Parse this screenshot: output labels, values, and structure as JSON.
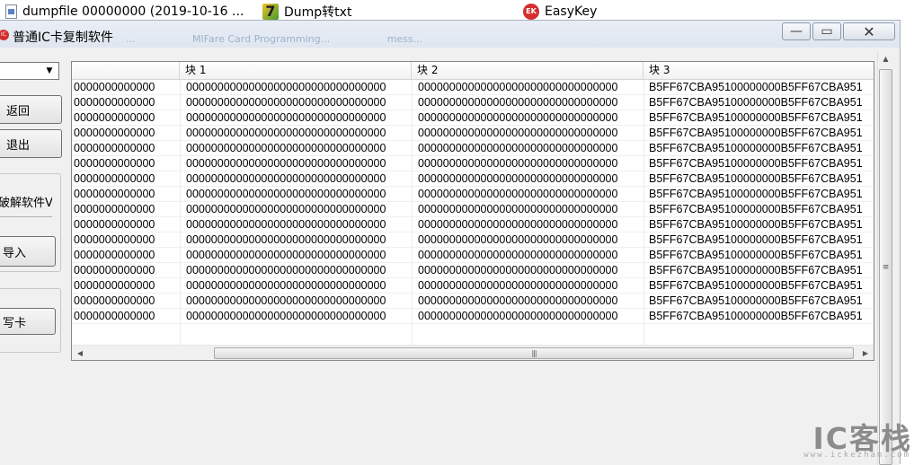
{
  "taskbar": {
    "items": [
      {
        "label": "dumpfile 00000000 (2019-10-16 ...",
        "icon": "file-icon"
      },
      {
        "label": "Dump转txt",
        "icon": "7zip-icon"
      },
      {
        "label": "EasyKey",
        "icon": "easykey-icon"
      }
    ]
  },
  "window": {
    "title": "普通IC卡复制软件",
    "background_tabs": [
      "...",
      "MIFare Card Programming...",
      "mess..."
    ],
    "caption": {
      "minimize": "—",
      "maximize": "▭",
      "close": "✕"
    }
  },
  "left_panel": {
    "combo_value": "",
    "back_label": "返回",
    "exit_label": "退出",
    "crack_label": "破解软件V",
    "import_label": "导入",
    "write_label": "写卡"
  },
  "grid": {
    "columns": [
      "",
      "块 1",
      "块 2",
      "块 3"
    ],
    "rows": [
      [
        "0000000000000",
        "00000000000000000000000000000000",
        "00000000000000000000000000000000",
        "B5FF67CBA95100000000B5FF67CBA951"
      ],
      [
        "0000000000000",
        "00000000000000000000000000000000",
        "00000000000000000000000000000000",
        "B5FF67CBA95100000000B5FF67CBA951"
      ],
      [
        "0000000000000",
        "00000000000000000000000000000000",
        "00000000000000000000000000000000",
        "B5FF67CBA95100000000B5FF67CBA951"
      ],
      [
        "0000000000000",
        "00000000000000000000000000000000",
        "00000000000000000000000000000000",
        "B5FF67CBA95100000000B5FF67CBA951"
      ],
      [
        "0000000000000",
        "00000000000000000000000000000000",
        "00000000000000000000000000000000",
        "B5FF67CBA95100000000B5FF67CBA951"
      ],
      [
        "0000000000000",
        "00000000000000000000000000000000",
        "00000000000000000000000000000000",
        "B5FF67CBA95100000000B5FF67CBA951"
      ],
      [
        "0000000000000",
        "00000000000000000000000000000000",
        "00000000000000000000000000000000",
        "B5FF67CBA95100000000B5FF67CBA951"
      ],
      [
        "0000000000000",
        "00000000000000000000000000000000",
        "00000000000000000000000000000000",
        "B5FF67CBA95100000000B5FF67CBA951"
      ],
      [
        "0000000000000",
        "00000000000000000000000000000000",
        "00000000000000000000000000000000",
        "B5FF67CBA95100000000B5FF67CBA951"
      ],
      [
        "0000000000000",
        "00000000000000000000000000000000",
        "00000000000000000000000000000000",
        "B5FF67CBA95100000000B5FF67CBA951"
      ],
      [
        "0000000000000",
        "00000000000000000000000000000000",
        "00000000000000000000000000000000",
        "B5FF67CBA95100000000B5FF67CBA951"
      ],
      [
        "0000000000000",
        "00000000000000000000000000000000",
        "00000000000000000000000000000000",
        "B5FF67CBA95100000000B5FF67CBA951"
      ],
      [
        "0000000000000",
        "00000000000000000000000000000000",
        "00000000000000000000000000000000",
        "B5FF67CBA95100000000B5FF67CBA951"
      ],
      [
        "0000000000000",
        "00000000000000000000000000000000",
        "00000000000000000000000000000000",
        "B5FF67CBA95100000000B5FF67CBA951"
      ],
      [
        "0000000000000",
        "00000000000000000000000000000000",
        "00000000000000000000000000000000",
        "B5FF67CBA95100000000B5FF67CBA951"
      ],
      [
        "0000000000000",
        "00000000000000000000000000000000",
        "00000000000000000000000000000000",
        "B5FF67CBA95100000000B5FF67CBA951"
      ]
    ]
  },
  "watermark": {
    "logo": "IC客栈",
    "url": "www.ickezhan.com"
  },
  "colors": {
    "window_bg": "#f0f0f0",
    "title_bg": "#dfe6f0",
    "accent_red": "#d32f2f"
  }
}
